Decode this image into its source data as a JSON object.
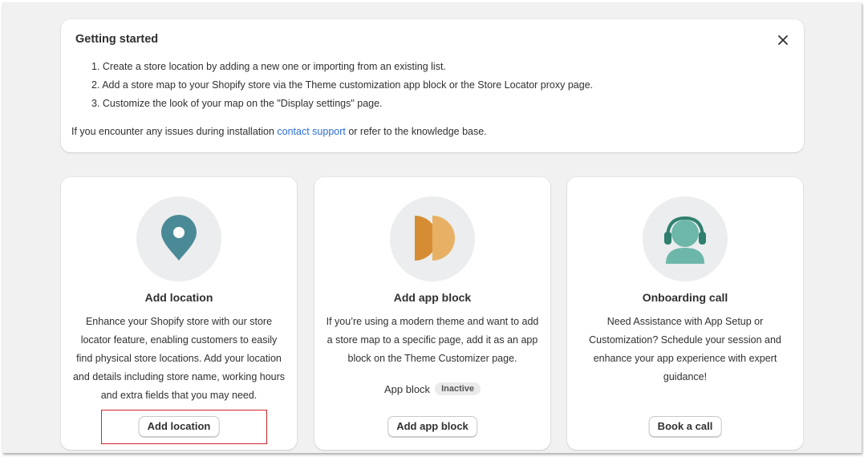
{
  "getting_started": {
    "title": "Getting started",
    "steps": [
      "1. Create a store location by adding a new one or importing from an existing list.",
      "2. Add a store map to your Shopify store via the Theme customization app block or the Store Locator proxy page.",
      "3. Customize the look of your map on the \"Display settings\" page."
    ],
    "footer_prefix": "If you encounter any issues during installation ",
    "footer_link": "contact support",
    "footer_suffix": " or refer to the knowledge base."
  },
  "cards": [
    {
      "icon": "map-pin-icon",
      "title": "Add location",
      "description": "Enhance your Shopify store with our store locator feature, enabling customers to easily find physical store locations. Add your location and details including store name, working hours and extra fields that you may need.",
      "button_label": "Add location"
    },
    {
      "icon": "app-block-icon",
      "title": "Add app block",
      "description": "If you’re using a modern theme and want to add a store map to a specific page, add it as an app block on the Theme Customizer page.",
      "status_label": "App block",
      "status_badge": "Inactive",
      "button_label": "Add app block"
    },
    {
      "icon": "headset-person-icon",
      "title": "Onboarding call",
      "description": "Need Assistance with App Setup or Customization? Schedule your session and enhance your app experience with expert guidance!",
      "button_label": "Book a call"
    }
  ],
  "colors": {
    "background": "#f1f1f1",
    "link": "#2a6ed4",
    "pin": "#4a8a96",
    "app_block_dark": "#d68c33",
    "app_block_light": "#e8b064",
    "headset": "#2f7f6e",
    "person": "#6db7aa",
    "highlight": "#d3242b"
  }
}
